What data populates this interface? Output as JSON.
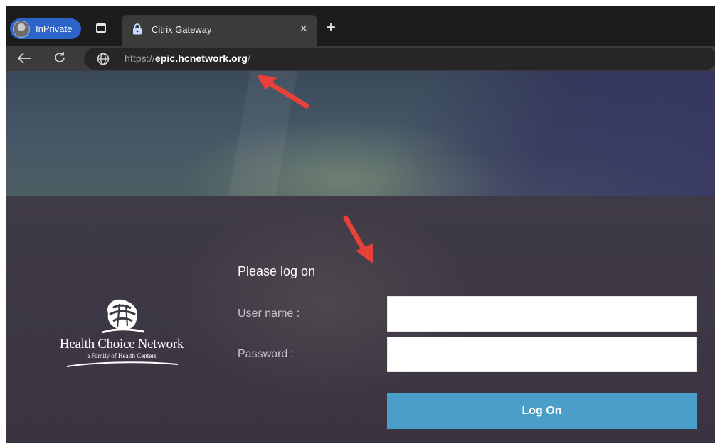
{
  "browser": {
    "profile_label": "InPrivate",
    "tab_title": "Citrix Gateway",
    "close_tab_glyph": "×",
    "new_tab_glyph": "+",
    "url_scheme": "https://",
    "url_domain": "epic.hcnetwork.org",
    "url_path": "/"
  },
  "logo": {
    "title": "Health Choice Network",
    "subtitle": "a Family of Health Centers"
  },
  "login_form": {
    "heading": "Please log on",
    "username_label": "User name :",
    "username_value": "",
    "password_label": "Password :",
    "password_value": "",
    "logon_button": "Log On"
  },
  "colors": {
    "inprivate_badge": "#2d64c8",
    "logon_button": "#4a9ec9",
    "annotation_arrow": "#e8403a"
  },
  "icons": [
    "inprivate-avatar-icon",
    "tab-actions-icon",
    "lock-icon",
    "close-icon",
    "plus-icon",
    "back-arrow-icon",
    "refresh-icon",
    "globe-icon"
  ]
}
